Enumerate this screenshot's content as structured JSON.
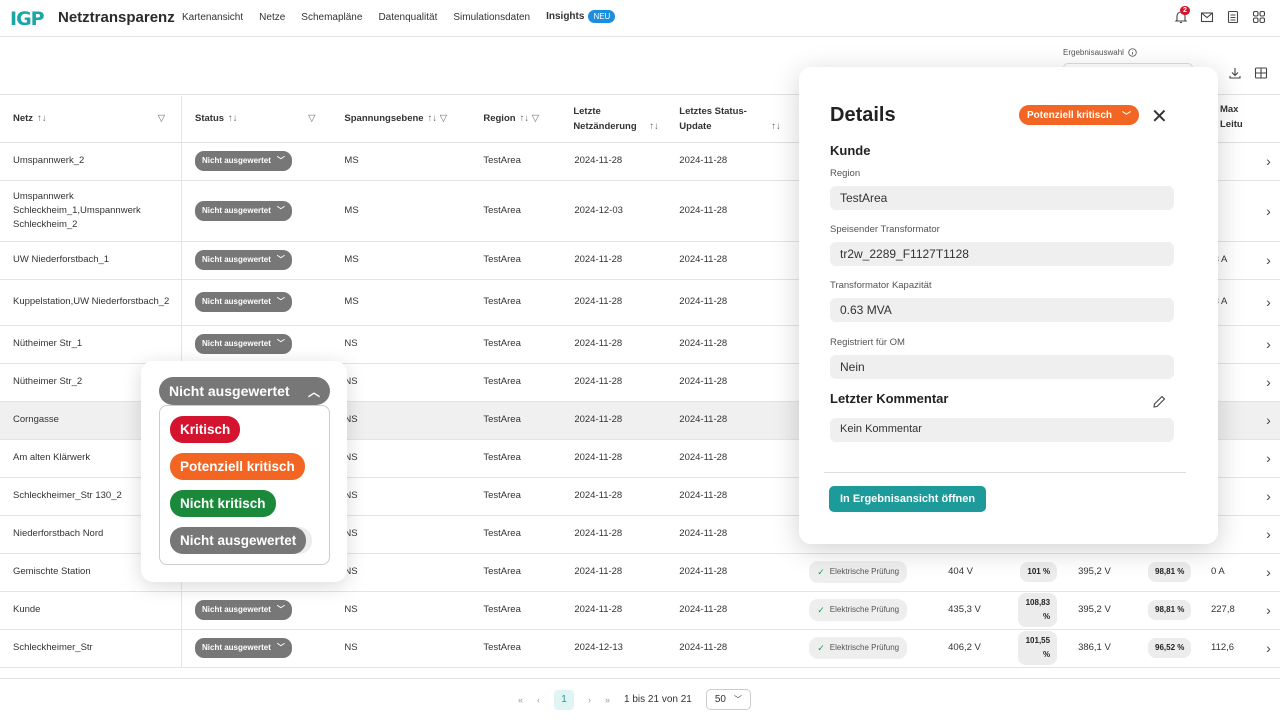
{
  "app": {
    "logo": "IGP",
    "title": "Netztransparenz",
    "nav": [
      "Kartenansicht",
      "Netze",
      "Schemapläne",
      "Datenqualität",
      "Simulationsdaten"
    ],
    "insights_label": "Insights",
    "insights_badge": "NEU",
    "notification_count": "2"
  },
  "toolbar": {
    "ergebnis_label": "Ergebnisauswahl"
  },
  "table": {
    "columns": [
      "Netz",
      "Status",
      "Spannungsebene",
      "Region",
      "Letzte Netzänderung",
      "Letztes Status-Update",
      "Max Leitu"
    ],
    "rows": [
      {
        "netz": "Umspannwerk_2",
        "status": "Nicht ausgewertet",
        "ebene": "MS",
        "region": "TestArea",
        "aenderung": "2024-11-28",
        "update": "2024-11-28",
        "extra": ""
      },
      {
        "netz": "Umspannwerk Schleckheim_1,Umspannwerk Schleckheim_2",
        "status": "Nicht ausgewertet",
        "ebene": "MS",
        "region": "TestArea",
        "aenderung": "2024-12-03",
        "update": "2024-11-28",
        "extra": ""
      },
      {
        "netz": "UW Niederforstbach_1",
        "status": "Nicht ausgewertet",
        "ebene": "MS",
        "region": "TestArea",
        "aenderung": "2024-11-28",
        "update": "2024-11-28",
        "extra": ",3 A"
      },
      {
        "netz": "Kuppelstation,UW Niederforstbach_2",
        "status": "Nicht ausgewertet",
        "ebene": "MS",
        "region": "TestArea",
        "aenderung": "2024-11-28",
        "update": "2024-11-28",
        "extra": ",3 A"
      },
      {
        "netz": "Nütheimer Str_1",
        "status": "Nicht ausgewertet",
        "ebene": "NS",
        "region": "TestArea",
        "aenderung": "2024-11-28",
        "update": "2024-11-28",
        "extra": ""
      },
      {
        "netz": "Nütheimer Str_2",
        "status": "",
        "ebene": "NS",
        "region": "TestArea",
        "aenderung": "2024-11-28",
        "update": "2024-11-28",
        "extra": ""
      },
      {
        "netz": "Corngasse",
        "status": "",
        "ebene": "NS",
        "region": "TestArea",
        "aenderung": "2024-11-28",
        "update": "2024-11-28",
        "extra": ""
      },
      {
        "netz": "Am alten Klärwerk",
        "status": "",
        "ebene": "NS",
        "region": "TestArea",
        "aenderung": "2024-11-28",
        "update": "2024-11-28",
        "extra": ""
      },
      {
        "netz": "Schleckheimer_Str 130_2",
        "status": "",
        "ebene": "NS",
        "region": "TestArea",
        "aenderung": "2024-11-28",
        "update": "2024-11-28",
        "extra": ""
      },
      {
        "netz": "Niederforstbach Nord",
        "status": "",
        "ebene": "NS",
        "region": "TestArea",
        "aenderung": "2024-11-28",
        "update": "2024-11-28",
        "extra": ""
      },
      {
        "netz": "Gemischte Station",
        "status": "",
        "ebene": "NS",
        "region": "TestArea",
        "aenderung": "2024-11-28",
        "update": "2024-11-28",
        "check": "Elektrische Prüfung",
        "v1": "404 V",
        "p1": "101 %",
        "v2": "395,2 V",
        "p2": "98,81 %",
        "extra": "0 A"
      },
      {
        "netz": "Kunde",
        "status": "Nicht ausgewertet",
        "ebene": "NS",
        "region": "TestArea",
        "aenderung": "2024-11-28",
        "update": "2024-11-28",
        "check": "Elektrische Prüfung",
        "v1": "435,3 V",
        "p1": "108,83 %",
        "v2": "395,2 V",
        "p2": "98,81 %",
        "extra": "227,8"
      },
      {
        "netz": "Schleckheimer_Str",
        "status": "Nicht ausgewertet",
        "ebene": "NS",
        "region": "TestArea",
        "aenderung": "2024-12-13",
        "update": "2024-11-28",
        "check": "Elektrische Prüfung",
        "v1": "406,2 V",
        "p1": "101,55 %",
        "v2": "386,1 V",
        "p2": "96,52 %",
        "extra": "112,6"
      }
    ]
  },
  "status_dropdown": {
    "current": "Nicht ausgewertet",
    "options": [
      {
        "label": "Kritisch",
        "color": "#d4132f"
      },
      {
        "label": "Potenziell kritisch",
        "color": "#f26522"
      },
      {
        "label": "Nicht kritisch",
        "color": "#1a8a3a"
      },
      {
        "label": "Nicht ausgewertet",
        "color": "#777777"
      }
    ]
  },
  "details": {
    "title": "Details",
    "status": "Potenziell kritisch",
    "section": "Kunde",
    "fields": [
      {
        "label": "Region",
        "value": "TestArea"
      },
      {
        "label": "Speisender Transformator",
        "value": "tr2w_2289_F1127T1128"
      },
      {
        "label": "Transformator Kapazität",
        "value": "0.63 MVA"
      },
      {
        "label": "Registriert für OM",
        "value": "Nein"
      }
    ],
    "comment_title": "Letzter Kommentar",
    "comment": "Kein Kommentar",
    "open_button": "In Ergebnisansicht öffnen"
  },
  "pagination": {
    "current_page": "1",
    "range": "1 bis 21 von 21",
    "page_size": "50"
  }
}
